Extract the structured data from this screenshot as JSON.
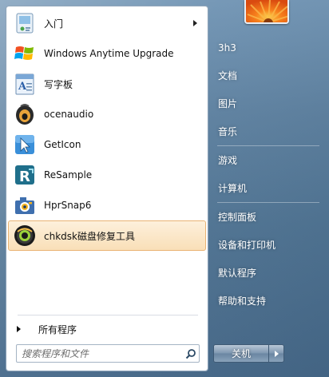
{
  "programs": [
    {
      "label": "入门",
      "icon": "getting-started-icon",
      "has_submenu": true
    },
    {
      "label": "Windows Anytime Upgrade",
      "icon": "windows-flag-icon"
    },
    {
      "label": "写字板",
      "icon": "wordpad-icon"
    },
    {
      "label": "ocenaudio",
      "icon": "ocenaudio-icon"
    },
    {
      "label": "GetIcon",
      "icon": "getIcon-icon"
    },
    {
      "label": "ReSample",
      "icon": "resample-icon"
    },
    {
      "label": "HprSnap6",
      "icon": "hprsnap-icon"
    },
    {
      "label": "chkdsk磁盘修复工具",
      "icon": "chkdsk-icon",
      "highlighted": true
    }
  ],
  "all_programs": {
    "label": "所有程序"
  },
  "search": {
    "placeholder": "搜索程序和文件"
  },
  "right_links": [
    {
      "label": "3h3"
    },
    {
      "label": "文档"
    },
    {
      "label": "图片"
    },
    {
      "label": "音乐"
    },
    {
      "label": "游戏"
    },
    {
      "label": "计算机"
    },
    {
      "label": "控制面板"
    },
    {
      "label": "设备和打印机"
    },
    {
      "label": "默认程序"
    },
    {
      "label": "帮助和支持"
    }
  ],
  "shutdown": {
    "label": "关机"
  },
  "colors": {
    "highlight": "#f9dfb8",
    "highlight_border": "#e9b374",
    "frame": "#5b7f9f"
  }
}
